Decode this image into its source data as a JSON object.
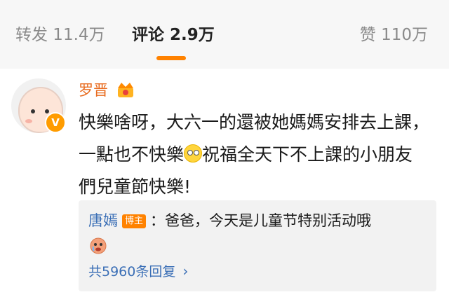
{
  "tabs": {
    "repost": "转发 11.4万",
    "comment": "评论 2.9万",
    "like": "赞 110万"
  },
  "comment": {
    "username": "罗晋",
    "text_part1": "快樂啥呀，大六一的還被她媽媽安排去上課，一點也不快樂",
    "text_part2": "祝福全天下不上課的小朋友們兒童節快樂!",
    "avatar_badge": "V"
  },
  "reply": {
    "name": "唐嫣",
    "badge": "博主",
    "text": "：爸爸，今天是儿童节特别活动哦",
    "more": "共5960条回复",
    "more_chevron": "›"
  },
  "icons": {
    "crown": "crown-icon",
    "inline_emoji": "rolling-eyes-emoji-icon",
    "reply_emoji": "crying-emoji-icon",
    "vip": "vip-badge-icon"
  },
  "colors": {
    "accent": "#ff8200",
    "username": "#e86b1f",
    "link": "#3b6fb6"
  }
}
